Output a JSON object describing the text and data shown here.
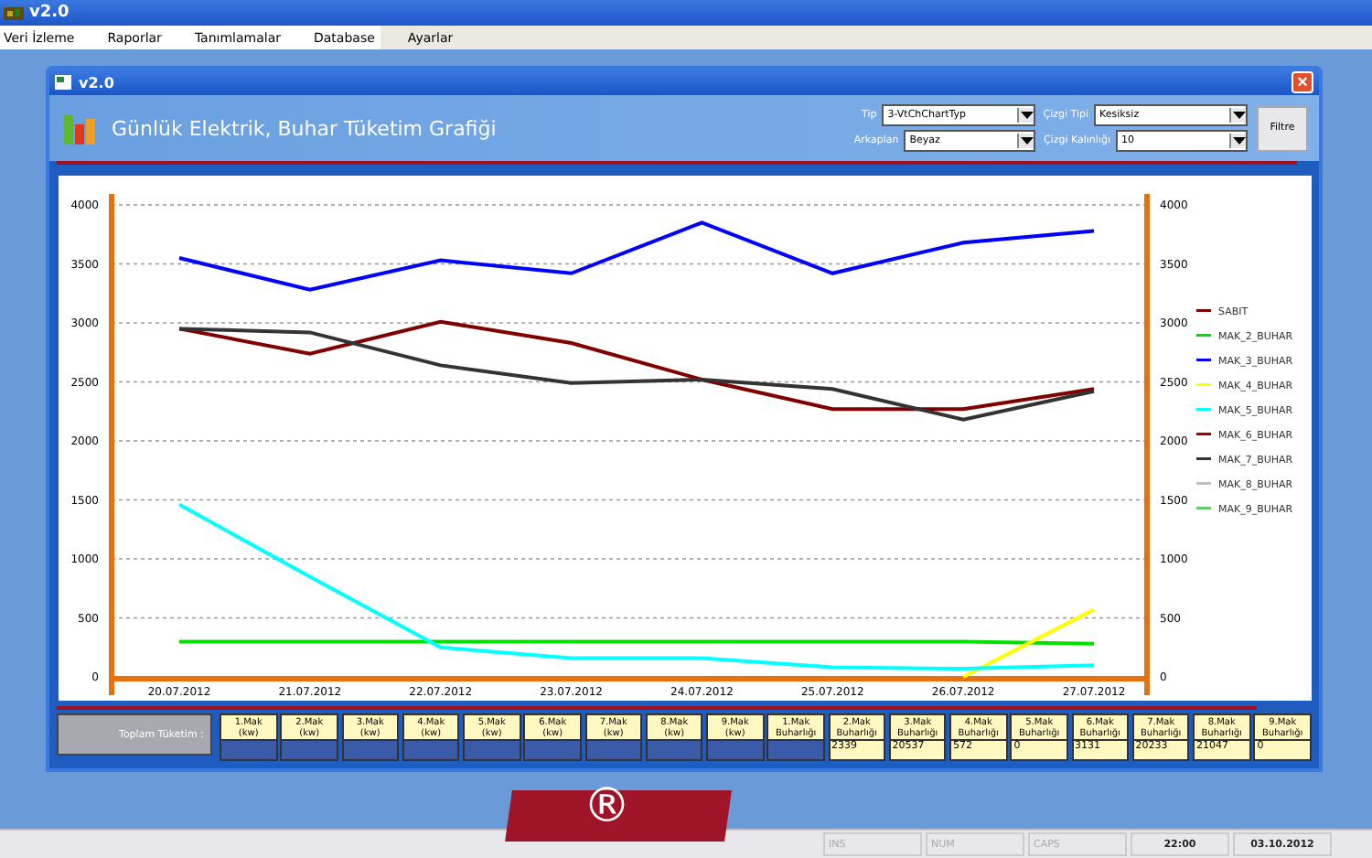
{
  "app": {
    "title": "v2.0"
  },
  "menu": [
    {
      "label": "Veri İzleme"
    },
    {
      "label": "Raporlar"
    },
    {
      "label": "Tanımlamalar"
    },
    {
      "label": "Database"
    },
    {
      "label": "Ayarlar"
    }
  ],
  "window": {
    "title": "v2.0",
    "close": "×",
    "heading": "Günlük Elektrik, Buhar Tüketim Grafiği"
  },
  "filters": [
    {
      "label": "Tip",
      "value": "3-VtChChartTyp"
    },
    {
      "label": "Çizgi Tipi",
      "value": "Kesiksiz"
    },
    {
      "label": "Arkaplan",
      "value": "Beyaz"
    },
    {
      "label": "Çizgi Kalınlığı",
      "value": "10"
    }
  ],
  "filter_button": "Filtre",
  "chart_data": {
    "type": "line",
    "x": [
      "20.07.2012",
      "21.07.2012",
      "22.07.2012",
      "23.07.2012",
      "24.07.2012",
      "25.07.2012",
      "26.07.2012",
      "27.07.2012"
    ],
    "ylim": [
      0,
      4000
    ],
    "yticks": [
      0,
      500,
      1000,
      1500,
      2000,
      2500,
      3000,
      3500,
      4000
    ],
    "y2ticks": [
      0,
      500,
      1000,
      1500,
      2000,
      2500,
      3000,
      3500,
      4000
    ],
    "y2lim": [
      0,
      4000
    ],
    "grid": true,
    "legend": true,
    "series": [
      {
        "name": "SABIT",
        "color": "#800000",
        "values": [
          2950,
          2740,
          3010,
          2830,
          2520,
          2270,
          2270,
          2440
        ]
      },
      {
        "name": "MAK_2_BUHAR",
        "color": "#00e000",
        "values": [
          300,
          300,
          300,
          300,
          300,
          300,
          300,
          280
        ]
      },
      {
        "name": "MAK_3_BUHAR",
        "color": "#0000ff",
        "values": [
          3550,
          3280,
          3530,
          3420,
          3850,
          3420,
          3680,
          3780
        ]
      },
      {
        "name": "MAK_4_BUHAR",
        "color": "#ffff00",
        "values": [
          null,
          null,
          null,
          null,
          null,
          null,
          0,
          570
        ]
      },
      {
        "name": "MAK_5_BUHAR",
        "color": "#00ffff",
        "values": [
          1460,
          850,
          250,
          160,
          160,
          80,
          70,
          100
        ]
      },
      {
        "name": "MAK_6_BUHAR",
        "color": "#a00000",
        "values": [
          null,
          null,
          null,
          null,
          null,
          null,
          null,
          null
        ]
      },
      {
        "name": "MAK_7_BUHAR",
        "color": "#333333",
        "values": [
          2950,
          2920,
          2640,
          2490,
          2520,
          2440,
          2180,
          2420
        ]
      },
      {
        "name": "MAK_8_BUHAR",
        "color": "#c0c0c0",
        "values": [
          null,
          null,
          null,
          null,
          null,
          null,
          null,
          null
        ]
      },
      {
        "name": "MAK_9_BUHAR",
        "color": "#66cc66",
        "values": [
          null,
          null,
          null,
          null,
          null,
          null,
          null,
          null
        ]
      }
    ]
  },
  "totals": {
    "label": "Toplam Tüketim :",
    "cells": [
      {
        "line1": "1.Mak",
        "line2": "(kw)"
      },
      {
        "line1": "2.Mak",
        "line2": "(kw)"
      },
      {
        "line1": "3.Mak",
        "line2": "(kw)"
      },
      {
        "line1": "4.Mak",
        "line2": "(kw)"
      },
      {
        "line1": "5.Mak",
        "line2": "(kw)"
      },
      {
        "line1": "6.Mak",
        "line2": "(kw)"
      },
      {
        "line1": "7.Mak",
        "line2": "(kw)"
      },
      {
        "line1": "8.Mak",
        "line2": "(kw)"
      },
      {
        "line1": "9.Mak",
        "line2": "(kw)"
      },
      {
        "line1": "1.Mak",
        "line2": "Buharlığı"
      },
      {
        "line1": "2.Mak",
        "line2": "Buharlığı",
        "value": "2339"
      },
      {
        "line1": "3.Mak",
        "line2": "Buharlığı",
        "value": "20537"
      },
      {
        "line1": "4.Mak",
        "line2": "Buharlığı",
        "value": "572"
      },
      {
        "line1": "5.Mak",
        "line2": "Buharlığı",
        "value": "0"
      },
      {
        "line1": "6.Mak",
        "line2": "Buharlığı",
        "value": "3131"
      },
      {
        "line1": "7.Mak",
        "line2": "Buharlığı",
        "value": "20233"
      },
      {
        "line1": "8.Mak",
        "line2": "Buharlığı",
        "value": "21047"
      },
      {
        "line1": "9.Mak",
        "line2": "Buharlığı",
        "value": "0"
      }
    ]
  },
  "logo_mark": "®",
  "status_bar": [
    {
      "text": "INS",
      "disabled": true
    },
    {
      "text": "NUM",
      "disabled": true
    },
    {
      "text": "CAPS",
      "disabled": true
    },
    {
      "text": "22:00",
      "disabled": false
    },
    {
      "text": "03.10.2012",
      "disabled": false
    }
  ]
}
